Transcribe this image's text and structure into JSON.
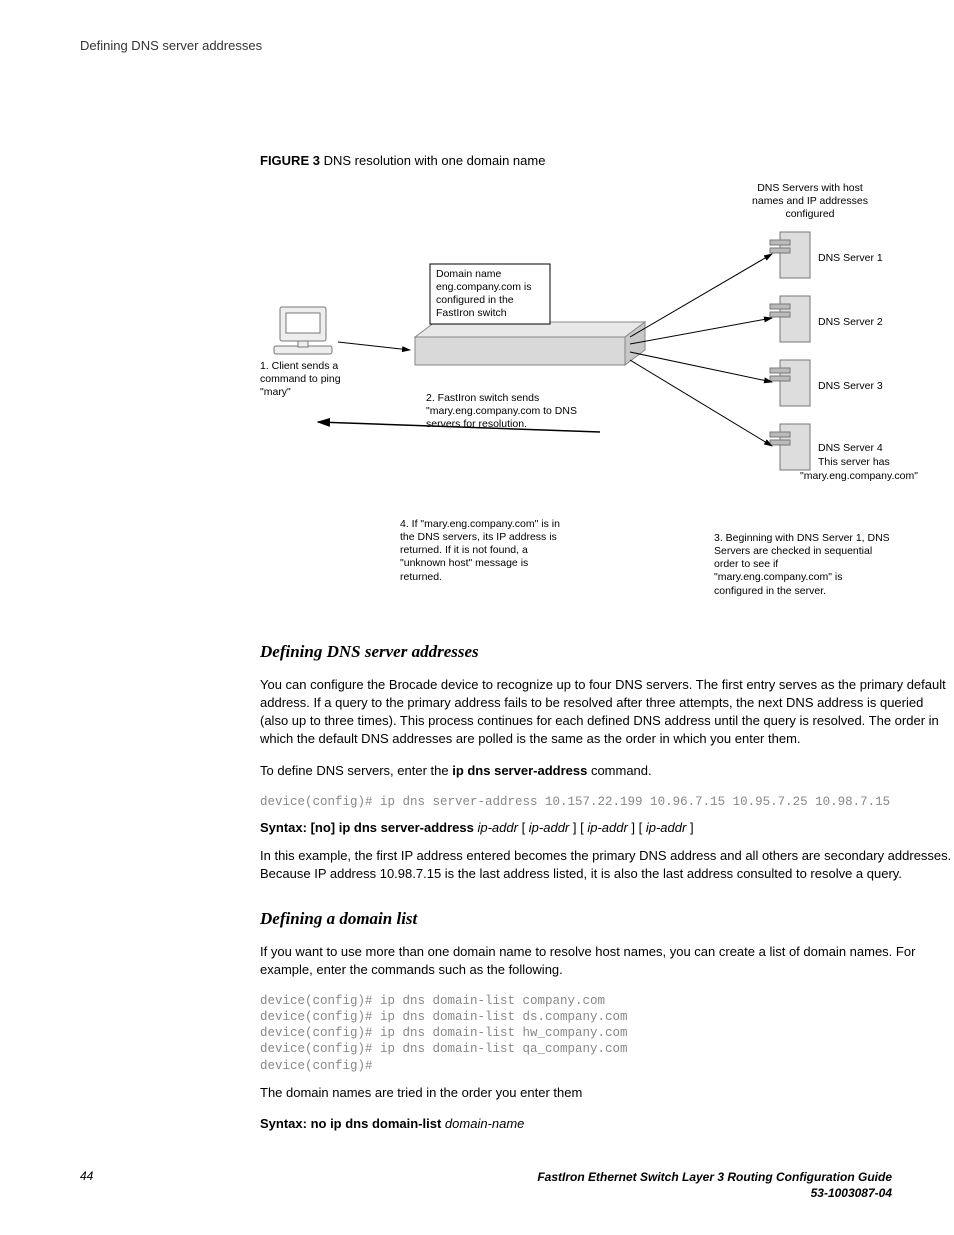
{
  "running_head": "Defining DNS server addresses",
  "figure": {
    "label": "FIGURE 3",
    "title": "DNS resolution with one domain name"
  },
  "diagram": {
    "top_note": "DNS Servers with host names and IP addresses configured",
    "step1": "1. Client sends a command to ping \"mary\"",
    "domain_box": "Domain name eng.company.com is configured in the FastIron switch",
    "step2": "2. FastIron switch sends \"mary.eng.company.com to DNS servers for resolution.",
    "step4": "4. If \"mary.eng.company.com\" is in the DNS servers, its IP address is returned. If it is not found, a \"unknown host\" message is returned.",
    "step3": "3. Beginning with DNS Server 1, DNS Servers are checked in sequential order to see if \"mary.eng.company.com\" is configured in the server.",
    "servers": {
      "s1": "DNS Server 1",
      "s2": "DNS Server 2",
      "s3": "DNS Server 3",
      "s4": "DNS Server 4",
      "s4_note1": "This server has",
      "s4_note2": "\"mary.eng.company.com\""
    }
  },
  "sections": {
    "dns_addr": {
      "title": "Defining DNS server addresses",
      "p1": "You can configure the Brocade device to recognize up to four DNS servers. The first entry serves as the primary default address. If a query to the primary address fails to be resolved after three attempts, the next DNS address is queried (also up to three times). This process continues for each defined DNS address until the query is resolved. The order in which the default DNS addresses are polled is the same as the order in which you enter them.",
      "p2_pre": "To define DNS servers, enter the ",
      "p2_cmd": "ip dns server-address",
      "p2_post": " command.",
      "code": "device(config)# ip dns server-address 10.157.22.199 10.96.7.15 10.95.7.25 10.98.7.15",
      "syntax_bold": "Syntax: [no] ip dns server-address",
      "syntax_ital": "ip-addr",
      "p3": "In this example, the first IP address entered becomes the primary DNS address and all others are secondary addresses. Because IP address 10.98.7.15 is the last address listed, it is also the last address consulted to resolve a query."
    },
    "domain_list": {
      "title": "Defining a domain list",
      "p1": "If you want to use more than one domain name to resolve host names, you can create a list of domain names. For example, enter the commands such as the following.",
      "code": "device(config)# ip dns domain-list company.com\ndevice(config)# ip dns domain-list ds.company.com\ndevice(config)# ip dns domain-list hw_company.com\ndevice(config)# ip dns domain-list qa_company.com\ndevice(config)#",
      "p2": "The domain names are tried in the order you enter them",
      "syntax_bold": "Syntax: no ip dns domain-list",
      "syntax_ital": "domain-name"
    }
  },
  "footer": {
    "page": "44",
    "guide_line1": "FastIron Ethernet Switch Layer 3 Routing Configuration Guide",
    "guide_line2": "53-1003087-04"
  }
}
